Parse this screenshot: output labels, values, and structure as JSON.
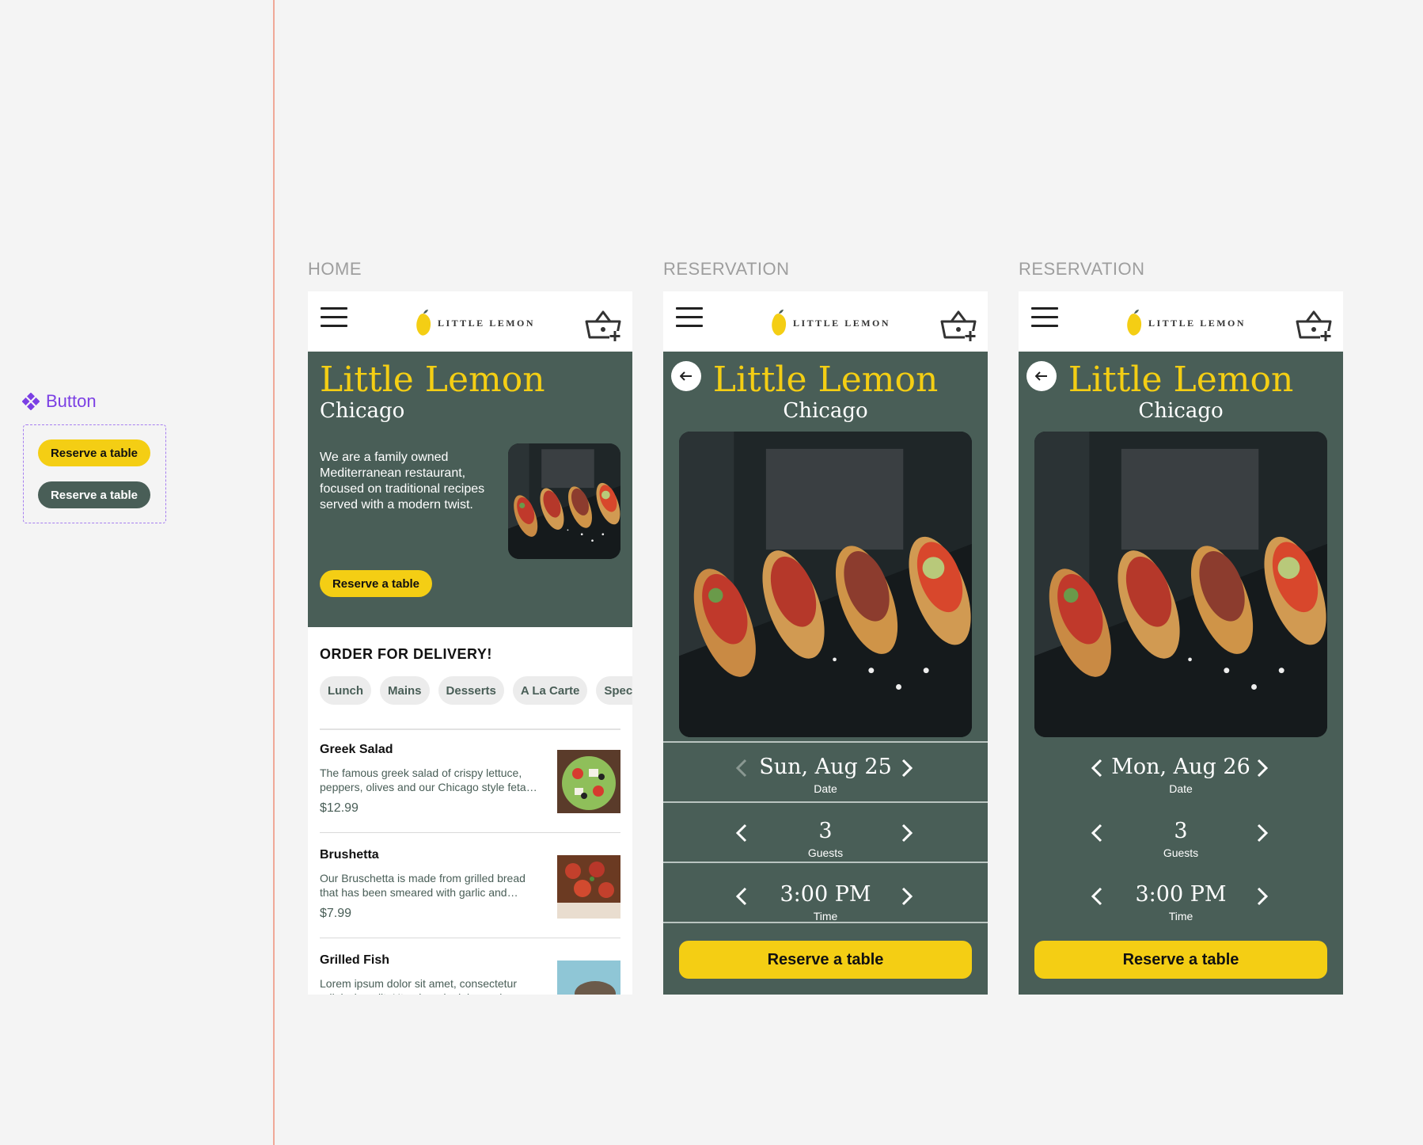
{
  "component_panel": {
    "title": "Button",
    "buttons": [
      {
        "label": "Reserve a table",
        "variant": "primary"
      },
      {
        "label": "Reserve a table",
        "variant": "secondary"
      }
    ]
  },
  "colors": {
    "primary_green": "#495e57",
    "primary_yellow": "#f4ce14",
    "component_purple": "#7b3fe4"
  },
  "frames": [
    {
      "label": "HOME"
    },
    {
      "label": "RESERVATION"
    },
    {
      "label": "RESERVATION"
    }
  ],
  "header": {
    "logo_text": "LITTLE LEMON",
    "menu_icon": "hamburger-icon",
    "cart_icon": "basket-add-icon"
  },
  "home": {
    "title": "Little Lemon",
    "subtitle": "Chicago",
    "description": "We are a family owned Mediterranean restaurant, focused on traditional recipes served with a modern twist.",
    "cta": "Reserve a table",
    "delivery_title": "ORDER FOR DELIVERY!",
    "categories": [
      "Lunch",
      "Mains",
      "Desserts",
      "A La Carte",
      "Specials"
    ],
    "dishes": [
      {
        "name": "Greek Salad",
        "description": "The famous greek salad of crispy lettuce, peppers, olives and our Chicago style feta cheese",
        "price": "$12.99"
      },
      {
        "name": "Brushetta",
        "description": "Our Bruschetta is made from grilled bread that has been smeared with garlic and seasoned with salt",
        "price": "$7.99"
      },
      {
        "name": "Grilled Fish",
        "description": "Lorem ipsum dolor sit amet, consectetur adipiscing elit. Ut enim ad minim veniam",
        "price": ""
      }
    ]
  },
  "reservations": [
    {
      "title": "Little Lemon",
      "subtitle": "Chicago",
      "date": {
        "value": "Sun, Aug 25",
        "label": "Date",
        "prev_disabled": true
      },
      "guests": {
        "value": "3",
        "label": "Guests"
      },
      "time": {
        "value": "3:00 PM",
        "label": "Time"
      },
      "cta": "Reserve a table"
    },
    {
      "title": "Little Lemon",
      "subtitle": "Chicago",
      "date": {
        "value": "Mon, Aug 26",
        "label": "Date",
        "prev_disabled": false
      },
      "guests": {
        "value": "3",
        "label": "Guests"
      },
      "time": {
        "value": "3:00 PM",
        "label": "Time"
      },
      "cta": "Reserve a table"
    }
  ]
}
